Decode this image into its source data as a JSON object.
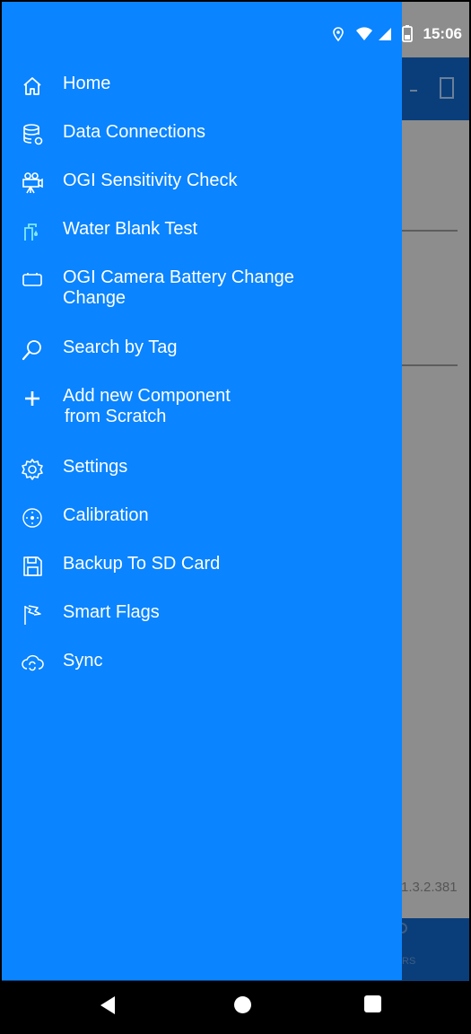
{
  "status_bar": {
    "time": "15:06",
    "icons": [
      "location-icon",
      "wifi-icon",
      "signal-icon",
      "battery-icon"
    ]
  },
  "background": {
    "version": "1.3.2.381",
    "bottom_label": "RS"
  },
  "drawer": {
    "background_color": "#0a84ff",
    "items": [
      {
        "label": "Home",
        "icon": "home-icon"
      },
      {
        "label": "Data Connections",
        "icon": "database-icon"
      },
      {
        "label": "OGI Sensitivity Check",
        "icon": "camera-icon"
      },
      {
        "label": "Water Blank Test",
        "icon": "water-tap-icon"
      },
      {
        "label": "OGI Camera Battery Change",
        "label2": "Change",
        "icon": "battery-outline-icon"
      },
      {
        "label": "Search by Tag",
        "icon": "search-icon"
      },
      {
        "label": "Add new Component",
        "label2": "from Scratch",
        "icon": "plus-icon"
      },
      {
        "label": "Settings",
        "icon": "gear-icon"
      },
      {
        "label": "Calibration",
        "icon": "calibration-icon"
      },
      {
        "label": "Backup To SD Card",
        "icon": "save-icon"
      },
      {
        "label": "Smart Flags",
        "icon": "flag-icon"
      },
      {
        "label": "Sync",
        "icon": "cloud-sync-icon"
      }
    ]
  },
  "nav_bar": {
    "back": "back-icon",
    "home": "home-circle-icon",
    "recent": "recent-apps-icon"
  }
}
